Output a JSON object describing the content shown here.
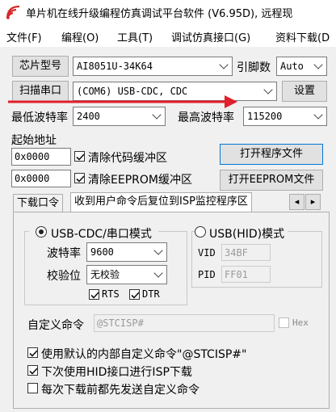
{
  "window": {
    "title": "单片机在线升级编程仿真调试平台软件 (V6.95D), 远程现",
    "icon": "stc-wave-icon"
  },
  "menu": [
    "文件(F)",
    "编程(O)",
    "工具(T)",
    "调试仿真接口(G)",
    "资料下载(D"
  ],
  "chip": {
    "button_label": "芯片型号",
    "model": "AI8051U-34K64",
    "pins_label": "引脚数",
    "pins_value": "Auto"
  },
  "port": {
    "scan_label": "扫描串口",
    "value": "(COM6) USB-CDC, CDC",
    "settings_label": "设置"
  },
  "baud": {
    "min_label": "最低波特率",
    "min_value": "2400",
    "max_label": "最高波特率",
    "max_value": "115200"
  },
  "address": {
    "label": "起始地址",
    "code_addr": "0x0000",
    "code_clear_label": "清除代码缓冲区",
    "code_clear_checked": true,
    "eeprom_addr": "0x0000",
    "eeprom_clear_label": "清除EEPROM缓冲区",
    "eeprom_clear_checked": true,
    "open_program_label": "打开程序文件",
    "open_eeprom_label": "打开EEPROM文件"
  },
  "tabs": {
    "items": [
      "下载口令",
      "收到用户命令后复位到ISP监控程序区"
    ],
    "active": 1,
    "scroll_left": "◂",
    "scroll_right": "▸"
  },
  "panel": {
    "cdc_mode_label": "USB-CDC/串口模式",
    "cdc_selected": true,
    "baud_label": "波特率",
    "baud_value": "9600",
    "parity_label": "校验位",
    "parity_value": "无校验",
    "rts_label": "RTS",
    "rts_checked": true,
    "dtr_label": "DTR",
    "dtr_checked": true,
    "hid_mode_label": "USB(HID)模式",
    "hid_selected": false,
    "vid_label": "VID",
    "vid_value": "34BF",
    "pid_label": "PID",
    "pid_value": "FF01",
    "custom_cmd_label": "自定义命令",
    "custom_cmd_value": "@STCISP#",
    "hex_label": "Hex",
    "hex_checked": false,
    "opt1_label": "使用默认的内部自定义命令\"@STCISP#\"",
    "opt1_checked": true,
    "opt2_label": "下次使用HID接口进行ISP下载",
    "opt2_checked": true,
    "opt3_label": "每次下载前都先发送自定义命令",
    "opt3_checked": false
  },
  "colors": {
    "annotation_arrow": "#e0202a",
    "focus_border": "#0078d7"
  }
}
